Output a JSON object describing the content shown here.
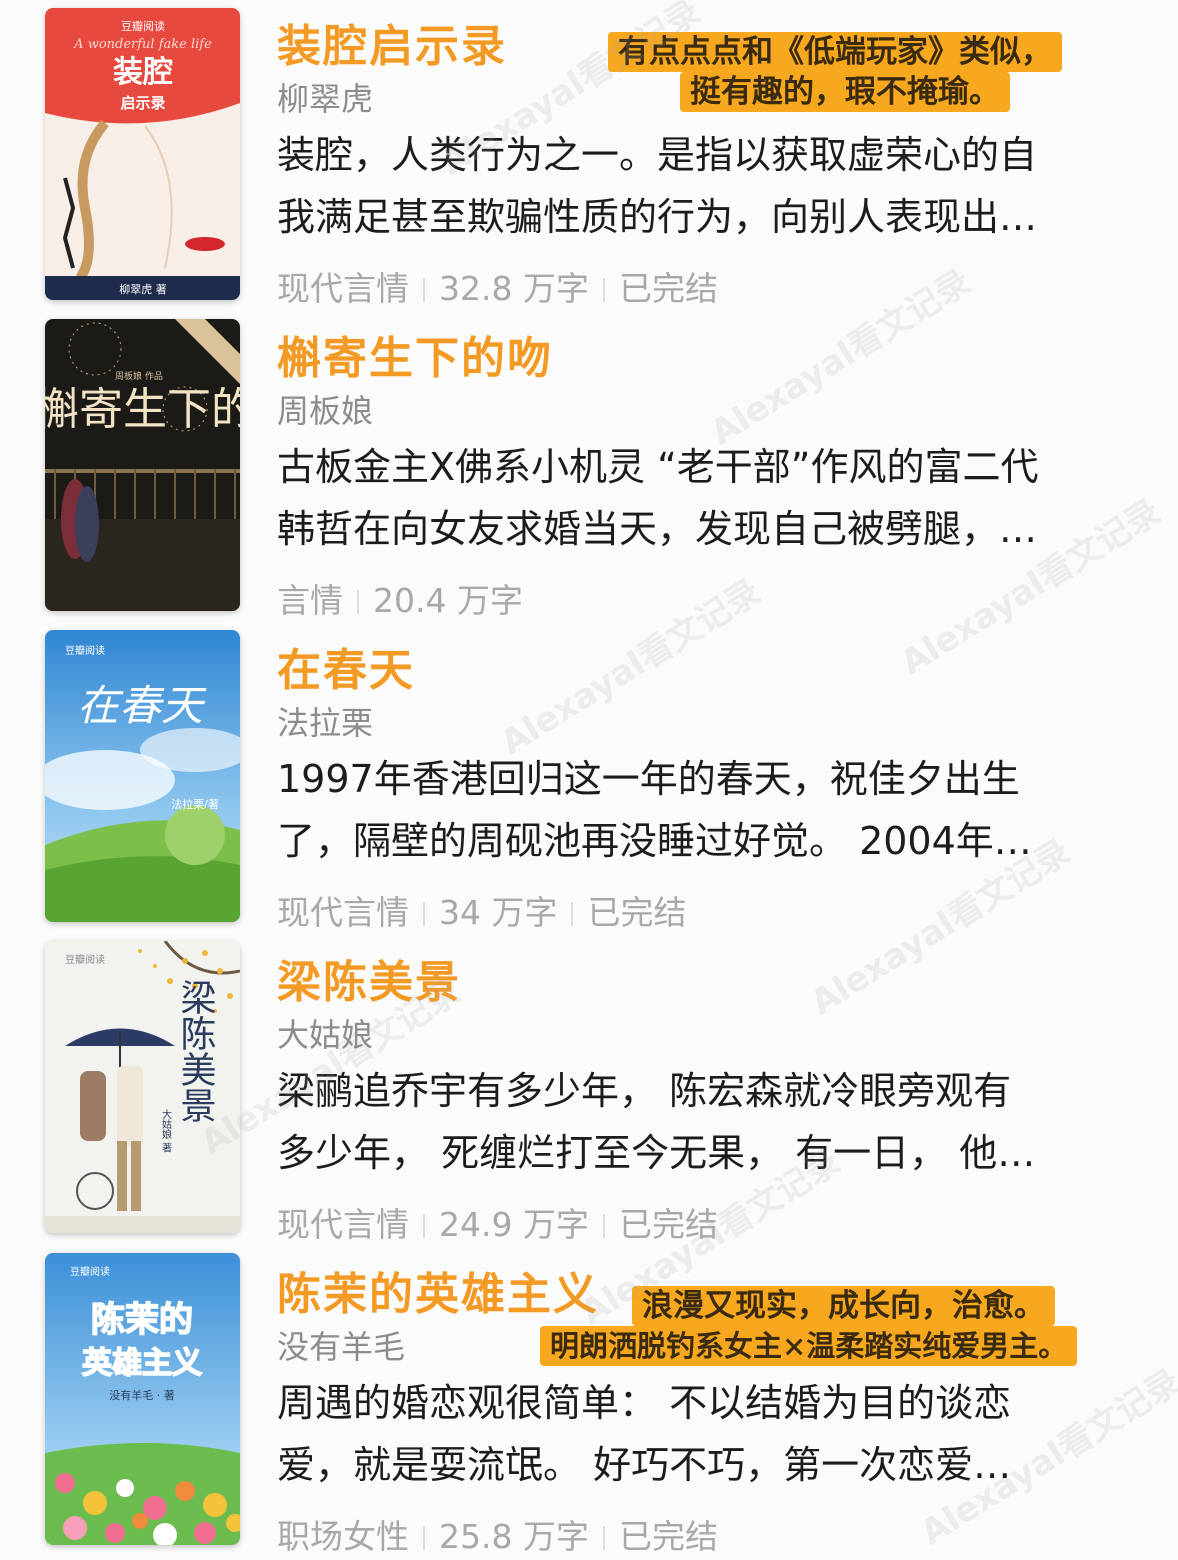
{
  "books": [
    {
      "title": "装腔启示录",
      "author": "柳翠虎",
      "desc_line1": "装腔，人类行为之一。是指以获取虚荣心的自",
      "desc_line2": "我满足甚至欺骗性质的行为，向别人表现出…",
      "genre": "现代言情",
      "words": "32.8 万字",
      "status": "已完结",
      "cover": {
        "tagline": "A wonderful fake life",
        "title_line1": "装腔",
        "title_line2": "启示录",
        "author_line": "柳翠虎 著",
        "publisher": "豆瓣阅读"
      }
    },
    {
      "title": "槲寄生下的吻",
      "author": "周板娘",
      "desc_line1": "古板金主X佛系小机灵 “老干部”作风的富二代",
      "desc_line2": "韩哲在向女友求婚当天，发现自己被劈腿，…",
      "genre": "言情",
      "words": "20.4 万字",
      "status": "",
      "cover": {
        "title_chars": "槲寄生下的吻",
        "author_line": "周板娘 作品"
      }
    },
    {
      "title": "在春天",
      "author": "法拉栗",
      "desc_line1": "1997年香港回归这一年的春天，祝佳夕出生",
      "desc_line2": "了，隔壁的周砚池再没睡过好觉。 2004年…",
      "genre": "现代言情",
      "words": "34 万字",
      "status": "已完结",
      "cover": {
        "title_chars": "在春天",
        "author_line": "法拉栗/著",
        "publisher": "豆瓣阅读"
      }
    },
    {
      "title": "梁陈美景",
      "author": "大姑娘",
      "desc_line1": "梁鹂追乔宇有多少年， 陈宏森就冷眼旁观有",
      "desc_line2": "多少年， 死缠烂打至今无果， 有一日， 他…",
      "genre": "现代言情",
      "words": "24.9 万字",
      "status": "已完结",
      "cover": {
        "title_chars": "梁陈美景",
        "author_line": "大姑娘 著",
        "publisher": "豆瓣阅读"
      }
    },
    {
      "title": "陈茉的英雄主义",
      "author": "没有羊毛",
      "desc_line1": "周遇的婚恋观很简单： 不以结婚为目的谈恋",
      "desc_line2": "爱，就是耍流氓。 好巧不巧，第一次恋爱…",
      "genre": "职场女性",
      "words": "25.8 万字",
      "status": "已完结",
      "cover": {
        "title_line1": "陈茉的",
        "title_line2": "英雄主义",
        "author_line": "没有羊毛 · 著",
        "publisher": "豆瓣阅读"
      }
    }
  ],
  "notes": {
    "note1_line1": "有点点点和《低端玩家》类似，",
    "note1_line2": "挺有趣的，瑕不掩瑜。",
    "note2_line1": "浪漫又现实，成长向，治愈。",
    "note2_line2": "明朗洒脱钓系女主×温柔踏实纯爱男主。"
  },
  "watermark": "Alexayal看文记录",
  "colors": {
    "title": "#f39a24",
    "highlight": "#f7a81e"
  }
}
